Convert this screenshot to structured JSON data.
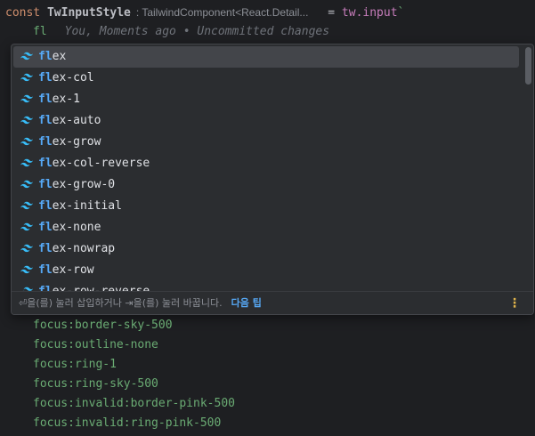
{
  "code": {
    "keyword": "const",
    "identifier": "TwInputStyle",
    "type_hint": ": TailwindComponent<React.Detail...",
    "operator": "=",
    "object": "tw.input",
    "backtick": "`",
    "typed_text": "fl",
    "blame_text": "You, Moments ago • Uncommitted changes"
  },
  "autocomplete": {
    "match_prefix": "fl",
    "items": [
      {
        "rest": "ex"
      },
      {
        "rest": "ex-col"
      },
      {
        "rest": "ex-1"
      },
      {
        "rest": "ex-auto"
      },
      {
        "rest": "ex-grow"
      },
      {
        "rest": "ex-col-reverse"
      },
      {
        "rest": "ex-grow-0"
      },
      {
        "rest": "ex-initial"
      },
      {
        "rest": "ex-none"
      },
      {
        "rest": "ex-nowrap"
      },
      {
        "rest": "ex-row"
      },
      {
        "rest": "ex-row-reverse"
      }
    ],
    "icon": "tailwind-icon",
    "footer_hint": "⏎을(를) 눌러 삽입하거나 ⇥을(를) 눌러 바꿉니다.",
    "footer_link": "다음 팁",
    "more_icon": "⋮"
  },
  "below_lines": [
    "focus:border-sky-500",
    "focus:outline-none",
    "focus:ring-1",
    "focus:ring-sky-500",
    "focus:invalid:border-pink-500",
    "focus:invalid:ring-pink-500"
  ],
  "colors": {
    "background": "#1e1f22",
    "popup_bg": "#2b2d30",
    "selection": "#43454a",
    "match": "#56a8f5",
    "string": "#6aab73",
    "keyword": "#cf8e6d",
    "tailwind": "#38bdf8"
  }
}
